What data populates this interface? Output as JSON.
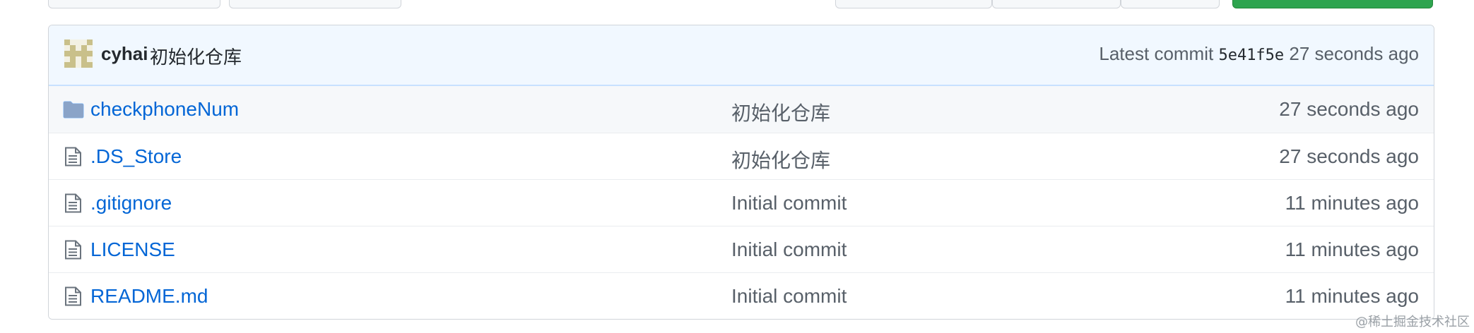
{
  "latest_commit": {
    "author": "cyhai",
    "message": "初始化仓库",
    "prefix": "Latest commit",
    "sha": "5e41f5e",
    "age": "27 seconds ago",
    "avatar_color": "#c9c08a"
  },
  "files": [
    {
      "type": "folder",
      "icon": "folder-icon",
      "name": "checkphoneNum",
      "message": "初始化仓库",
      "age": "27 seconds ago"
    },
    {
      "type": "file",
      "icon": "file-icon",
      "name": ".DS_Store",
      "message": "初始化仓库",
      "age": "27 seconds ago"
    },
    {
      "type": "file",
      "icon": "file-icon",
      "name": ".gitignore",
      "message": "Initial commit",
      "age": "11 minutes ago"
    },
    {
      "type": "file",
      "icon": "file-icon",
      "name": "LICENSE",
      "message": "Initial commit",
      "age": "11 minutes ago"
    },
    {
      "type": "file",
      "icon": "file-icon",
      "name": "README.md",
      "message": "Initial commit",
      "age": "11 minutes ago"
    }
  ],
  "colors": {
    "link": "#0366d6",
    "header_bg": "#f1f8ff",
    "green_button": "#2ea44f"
  },
  "watermark": "@稀土掘金技术社区"
}
